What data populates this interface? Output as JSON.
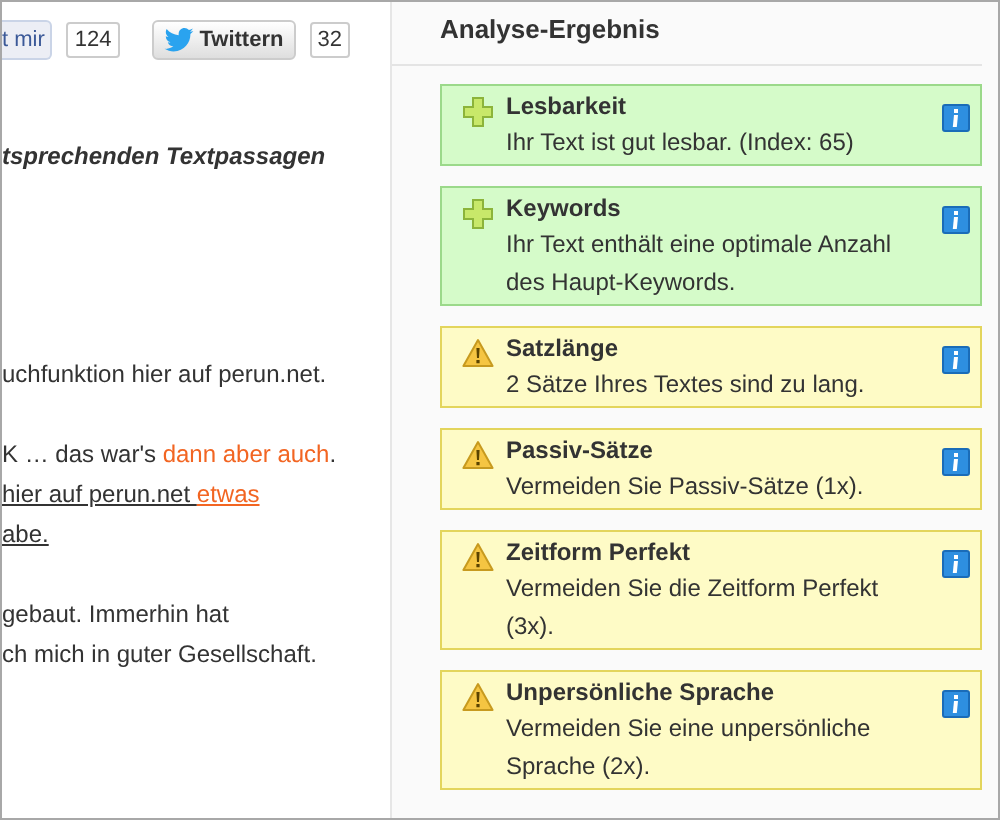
{
  "social": {
    "like_button": "t mir",
    "like_count": "124",
    "tweet_button": "Twittern",
    "tweet_count": "32"
  },
  "article": {
    "heading": "tsprechenden Textpassagen",
    "paragraphs": [
      {
        "lines": [
          [
            {
              "kind": "text",
              "text": "uchfunktion hier auf perun.net."
            }
          ]
        ]
      },
      {
        "lines": [
          [
            {
              "kind": "text",
              "text": "K … das war's "
            },
            {
              "kind": "highlight",
              "text": "dann aber auch"
            },
            {
              "kind": "text",
              "text": "."
            }
          ],
          [
            {
              "kind": "link",
              "text": "hier auf perun.net "
            },
            {
              "kind": "highlight-link",
              "text": "etwas"
            }
          ],
          [
            {
              "kind": "link",
              "text": "abe."
            }
          ]
        ]
      },
      {
        "lines": [
          [
            {
              "kind": "text",
              "text": "gebaut. Immerhin hat"
            }
          ],
          [
            {
              "kind": "text",
              "text": "ch mich in guter Gesellschaft."
            }
          ]
        ]
      }
    ]
  },
  "analysis": {
    "title": "Analyse-Ergebnis",
    "results": [
      {
        "kind": "good",
        "title": "Lesbarkeit",
        "text": "Ihr Text ist gut lesbar. (Index: 65)"
      },
      {
        "kind": "good",
        "title": "Keywords",
        "text": "Ihr Text enthält eine optimale Anzahl des Haupt-Keywords."
      },
      {
        "kind": "warning",
        "title": "Satzlänge",
        "text": "2 Sätze Ihres Textes sind zu lang."
      },
      {
        "kind": "warning",
        "title": "Passiv-Sätze",
        "text": "Vermeiden Sie Passiv-Sätze (1x)."
      },
      {
        "kind": "warning",
        "title": "Zeitform Perfekt",
        "text": "Vermeiden Sie die Zeitform Perfekt (3x)."
      },
      {
        "kind": "warning",
        "title": "Unpersönliche Sprache",
        "text": "Vermeiden Sie eine unpersönliche Sprache (2x)."
      }
    ]
  }
}
